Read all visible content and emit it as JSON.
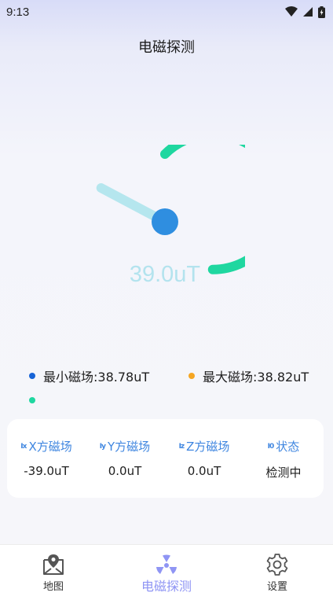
{
  "status": {
    "time": "9:13"
  },
  "page": {
    "title": "电磁探测"
  },
  "gauge": {
    "value_text": "39.0uT",
    "level_fraction": 0.27
  },
  "legend": {
    "min_label": "最小磁场:38.78uT",
    "max_label": "最大磁场:38.82uT"
  },
  "colors": {
    "accent_green": "#1fd7a0",
    "needle": "#b5e6ee",
    "hub": "#2f8ee0",
    "min_dot": "#1763d6",
    "max_dot": "#f5a623",
    "tab_active": "#8f95f4",
    "header_blue": "#3f86e0"
  },
  "readings": [
    {
      "badge": "Ⅰx",
      "label": "X方磁场",
      "value": "-39.0uT"
    },
    {
      "badge": "Ⅰy",
      "label": "Y方磁场",
      "value": "0.0uT"
    },
    {
      "badge": "Ⅰz",
      "label": "Z方磁场",
      "value": "0.0uT"
    },
    {
      "badge": "Ⅰ0",
      "label": "状态",
      "value": "检测中"
    }
  ],
  "tabs": [
    {
      "label": "地图",
      "icon": "map-icon",
      "active": false
    },
    {
      "label": "电磁探测",
      "icon": "radiation-icon",
      "active": true
    },
    {
      "label": "设置",
      "icon": "gear-icon",
      "active": false
    }
  ]
}
